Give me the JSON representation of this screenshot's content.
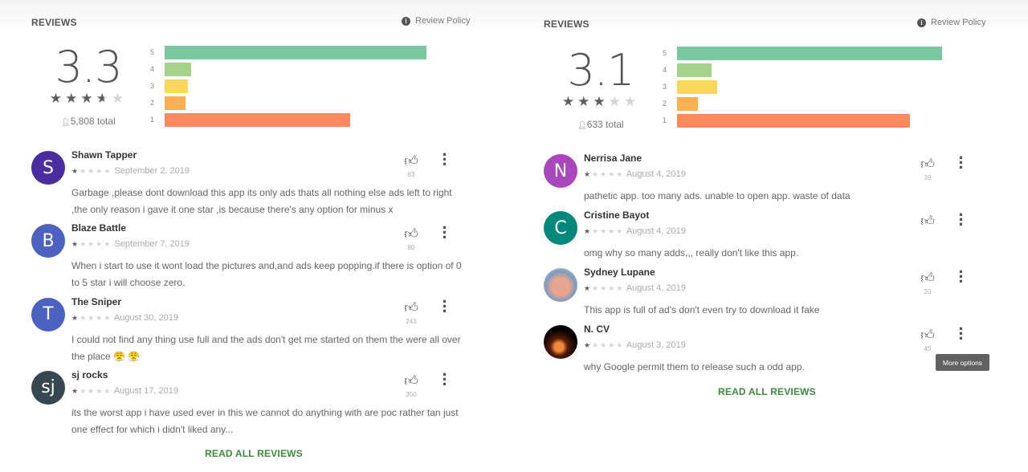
{
  "panels": [
    {
      "header": "REVIEWS",
      "policy": "Review Policy",
      "policy_icon": "info-icon",
      "rating": "3.3",
      "rating_stars": 3.5,
      "total": "5,808 total",
      "total_icon": "person-icon",
      "histogram": [
        {
          "label": "5",
          "relative": 1.0,
          "color": "#7bc8a0"
        },
        {
          "label": "4",
          "relative": 0.1,
          "color": "#a6d38a"
        },
        {
          "label": "3",
          "relative": 0.09,
          "color": "#fcd85a"
        },
        {
          "label": "2",
          "relative": 0.08,
          "color": "#fbb054"
        },
        {
          "label": "1",
          "relative": 0.71,
          "color": "#fb8b5e"
        }
      ],
      "reviews": [
        {
          "initial": "S",
          "avatar_color": "#4a2ea0",
          "name": "Shawn Tapper",
          "stars": 1,
          "date": "September 2, 2019",
          "likes": "63",
          "text": "Garbage ,please dont download this app its only ads thats all nothing else ads left to right ,the only reason i gave it one star ,is because there's any option for minus x"
        },
        {
          "initial": "B",
          "avatar_color": "#4d62c0",
          "name": "Blaze Battle",
          "stars": 1,
          "date": "September 7, 2019",
          "likes": "80",
          "text": "When i start to use it wont load the pictures and,and ads keep popping.if there is option of 0 to 5 star i will choose zero."
        },
        {
          "initial": "T",
          "avatar_color": "#4d62c0",
          "name": "The Sniper",
          "stars": 1,
          "date": "August 30, 2019",
          "likes": "243",
          "text": "I could not find any thing use full and the ads don't get me started on them the were all over the place 😤 😤"
        },
        {
          "initial": "sj",
          "avatar_color": "#37474f",
          "name": "sj rocks",
          "stars": 1,
          "date": "August 17, 2019",
          "likes": "350",
          "text": "its the worst app i have used ever in this we cannot do anything with are poc rather tan just one effect for which i didn't liked any..."
        }
      ],
      "read_all": "READ ALL REVIEWS"
    },
    {
      "header": "REVIEWS",
      "policy": "Review Policy",
      "policy_icon": "info-icon",
      "rating": "3.1",
      "rating_stars": 3,
      "total": "633 total",
      "total_icon": "person-icon",
      "histogram": [
        {
          "label": "5",
          "relative": 1.0,
          "color": "#7bc8a0"
        },
        {
          "label": "4",
          "relative": 0.13,
          "color": "#a6d38a"
        },
        {
          "label": "3",
          "relative": 0.15,
          "color": "#fcd85a"
        },
        {
          "label": "2",
          "relative": 0.08,
          "color": "#fbb054"
        },
        {
          "label": "1",
          "relative": 0.88,
          "color": "#fb8b5e"
        }
      ],
      "reviews": [
        {
          "initial": "N",
          "avatar_color": "#ab47bc",
          "name": "Nerrisa Jane",
          "stars": 1,
          "date": "August 4, 2019",
          "likes": "39",
          "text": "pathetic app. too many ads. unable to open app. waste of data"
        },
        {
          "initial": "C",
          "avatar_color": "#00897b",
          "name": "Cristine Bayot",
          "stars": 1,
          "date": "August 4, 2019",
          "likes": "",
          "text": "omg why so many adds,,, really don't like this app."
        },
        {
          "initial": "",
          "avatar_color": "#c9b3a5",
          "avatar_photo": true,
          "name": "Sydney Lupane",
          "stars": 1,
          "date": "August 4, 2019",
          "likes": "20",
          "text": "This app is full of ad's don't even try to download it fake"
        },
        {
          "initial": "",
          "avatar_color": "#1a0a05",
          "avatar_photo": true,
          "name": "N. CV",
          "stars": 1,
          "date": "August 3, 2019",
          "likes": "45",
          "text": "why Google permit them to release such a odd app."
        }
      ],
      "read_all": "READ ALL REVIEWS"
    }
  ],
  "tooltip": "More options"
}
